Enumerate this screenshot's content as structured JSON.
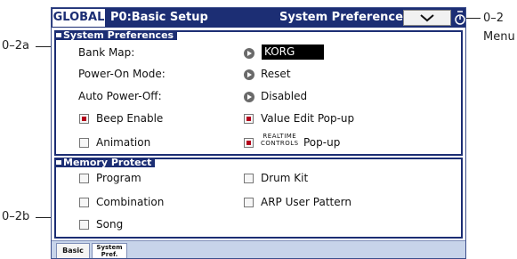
{
  "annotations": {
    "label_02a": "0–2a",
    "label_02b": "0–2b",
    "label_02": "0–2",
    "label_menu": "Menu"
  },
  "header": {
    "mode": "GLOBAL",
    "page": "P0:Basic Setup",
    "section_title": "System Preferences"
  },
  "system_preferences": {
    "header": "System Preferences",
    "bank_map": {
      "label": "Bank Map:",
      "value": "KORG"
    },
    "power_on_mode": {
      "label": "Power-On Mode:",
      "value": "Reset"
    },
    "auto_power_off": {
      "label": "Auto Power-Off:",
      "value": "Disabled"
    },
    "beep_enable": {
      "label": "Beep Enable",
      "checked": true
    },
    "value_edit_popup": {
      "label": "Value Edit Pop-up",
      "checked": true
    },
    "animation": {
      "label": "Animation",
      "checked": false
    },
    "realtime_controls_popup": {
      "label_top": "REALTIME",
      "label_bottom": "CONTROLS",
      "label_suffix": "Pop-up",
      "checked": true
    }
  },
  "memory_protect": {
    "header": "Memory Protect",
    "program": {
      "label": "Program",
      "checked": false
    },
    "drum_kit": {
      "label": "Drum Kit",
      "checked": false
    },
    "combination": {
      "label": "Combination",
      "checked": false
    },
    "arp_user_pattern": {
      "label": "ARP User Pattern",
      "checked": false
    },
    "song": {
      "label": "Song",
      "checked": false
    }
  },
  "tabs": {
    "basic": "Basic",
    "system_pref_line1": "System",
    "system_pref_line2": "Pref."
  },
  "colors": {
    "title_bar": "#1c2e74",
    "checkbox_on": "#b3001b",
    "tab_strip": "#c7d4ea"
  }
}
